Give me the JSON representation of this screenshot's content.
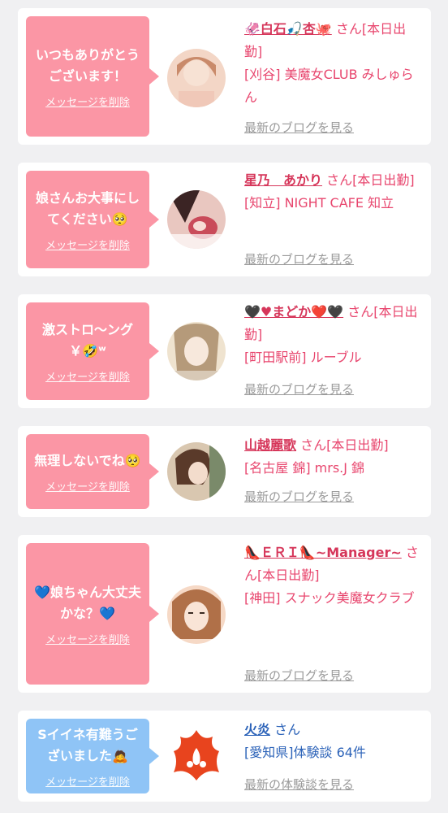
{
  "items": [
    {
      "message": "いつもありがとうございます！",
      "delete_label": "メッセージを削除",
      "name": "🦑白石🎣杏🐙",
      "suffix": "さん[本日出勤]",
      "shop": "[刈谷] 美魔女CLUB みしゅらん",
      "blog_label": "最新のブログを見る",
      "bubble_color": "#fb96a5",
      "avatar_colors": [
        "#f3d6c6",
        "#c98a6a"
      ]
    },
    {
      "message": "娘さんお大事にしてください🥺",
      "delete_label": "メッセージを削除",
      "name": "星乃　あかり",
      "suffix": "さん[本日出勤]",
      "shop": "[知立] NIGHT CAFE 知立",
      "blog_label": "最新のブログを見る",
      "bubble_color": "#fb96a5",
      "avatar_colors": [
        "#e9c7c0",
        "#7a3b3b"
      ]
    },
    {
      "message": "激ストロ〜ング￥🤣ʷ",
      "delete_label": "メッセージを削除",
      "name": "🖤♥まどか❤️🖤",
      "suffix": "さん[本日出勤]",
      "shop": "[町田駅前] ルーブル",
      "blog_label": "最新のブログを見る",
      "bubble_color": "#fb96a5",
      "avatar_colors": [
        "#efe3cf",
        "#b59a7a"
      ]
    },
    {
      "message": "無理しないでね🥺",
      "delete_label": "メッセージを削除",
      "name": "山越麗歌",
      "suffix": "さん[本日出勤]",
      "shop": "[名古屋 錦] mrs.J 錦",
      "blog_label": "最新のブログを見る",
      "bubble_color": "#fb96a5",
      "avatar_colors": [
        "#d9c7b0",
        "#5a3a2a"
      ]
    },
    {
      "message": "💙娘ちゃん大丈夫かな？💙",
      "delete_label": "メッセージを削除",
      "name": "👠ＥＲＩ👠~Manager~",
      "suffix": "さん[本日出勤]",
      "shop": "[神田] スナック美魔女クラブ",
      "blog_label": "最新のブログを見る",
      "bubble_color": "#fb96a5",
      "avatar_colors": [
        "#f6d9c6",
        "#b07048"
      ]
    },
    {
      "message": "Sイイネ有難うございました🙇",
      "delete_label": "メッセージを削除",
      "name": "火炎",
      "suffix": "さん",
      "shop": "[愛知県]体験談 64件",
      "blog_label": "最新の体験談を見る",
      "bubble_color": "#8fc4f6",
      "avatar_colors": [
        "#ffffff",
        "#e8441e"
      ]
    }
  ]
}
